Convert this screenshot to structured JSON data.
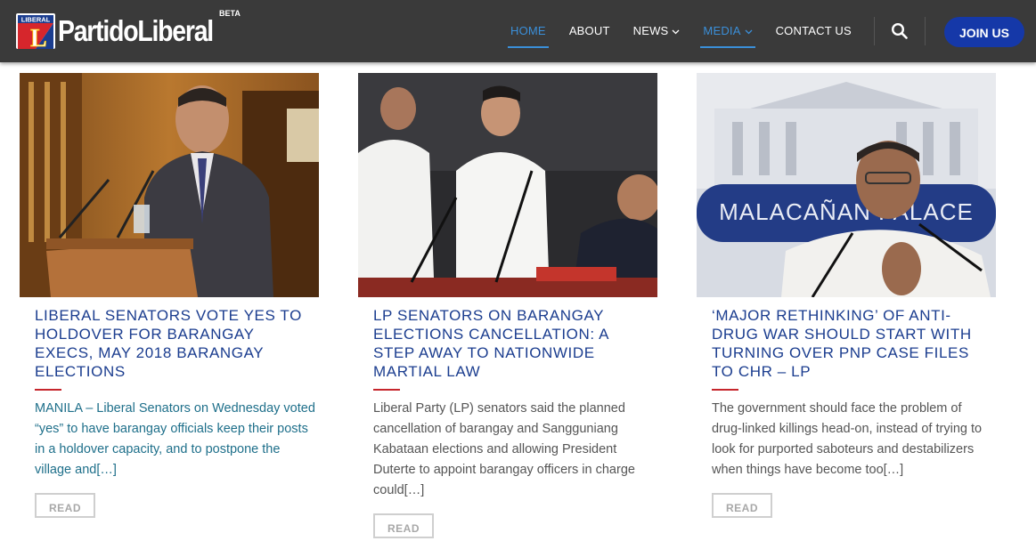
{
  "brand": {
    "name": "PartidoLiberal",
    "badge": "BETA",
    "emblem_text": "LIBERAL",
    "emblem_letter": "L"
  },
  "nav": {
    "items": [
      {
        "label": "HOME",
        "active": true
      },
      {
        "label": "ABOUT"
      },
      {
        "label": "NEWS",
        "dropdown": true
      },
      {
        "label": "MEDIA",
        "dropdown": true,
        "active": true
      },
      {
        "label": "CONTACT US"
      }
    ],
    "search_icon": "search-icon",
    "join_label": "JOIN US"
  },
  "colors": {
    "navbar": "#3a3a3a",
    "accent_blue": "#3a8fd9",
    "join_button": "#1538a8",
    "title_blue": "#1b3d8f",
    "rule_red": "#c6262c"
  },
  "articles": [
    {
      "photo_text": "",
      "title": "LIBERAL SENATORS VOTE YES TO HOLDOVER FOR BARANGAY EXECS, MAY 2018 BARANGAY ELECTIONS",
      "excerpt": "MANILA – Liberal Senators on Wednesday voted “yes” to have barangay officials keep their posts in a holdover capacity, and to postpone the village and[…]",
      "read_label": "READ"
    },
    {
      "photo_text": "",
      "title": "LP SENATORS ON BARANGAY ELECTIONS CANCELLATION: A STEP AWAY TO NATIONWIDE MARTIAL LAW",
      "excerpt": "Liberal Party (LP) senators said the planned cancellation of barangay and Sangguniang Kabataan elections and allowing President Duterte to appoint barangay officers in charge could[…]",
      "read_label": "READ"
    },
    {
      "photo_text": "MALACAÑAN PALACE",
      "title": "‘MAJOR RETHINKING’ OF ANTI-DRUG WAR SHOULD START WITH TURNING OVER PNP CASE FILES TO CHR – LP",
      "excerpt": "The government should face the problem of drug-linked killings head-on, instead of trying to look for purported saboteurs and destabilizers when things have become too[…]",
      "read_label": "READ"
    }
  ]
}
